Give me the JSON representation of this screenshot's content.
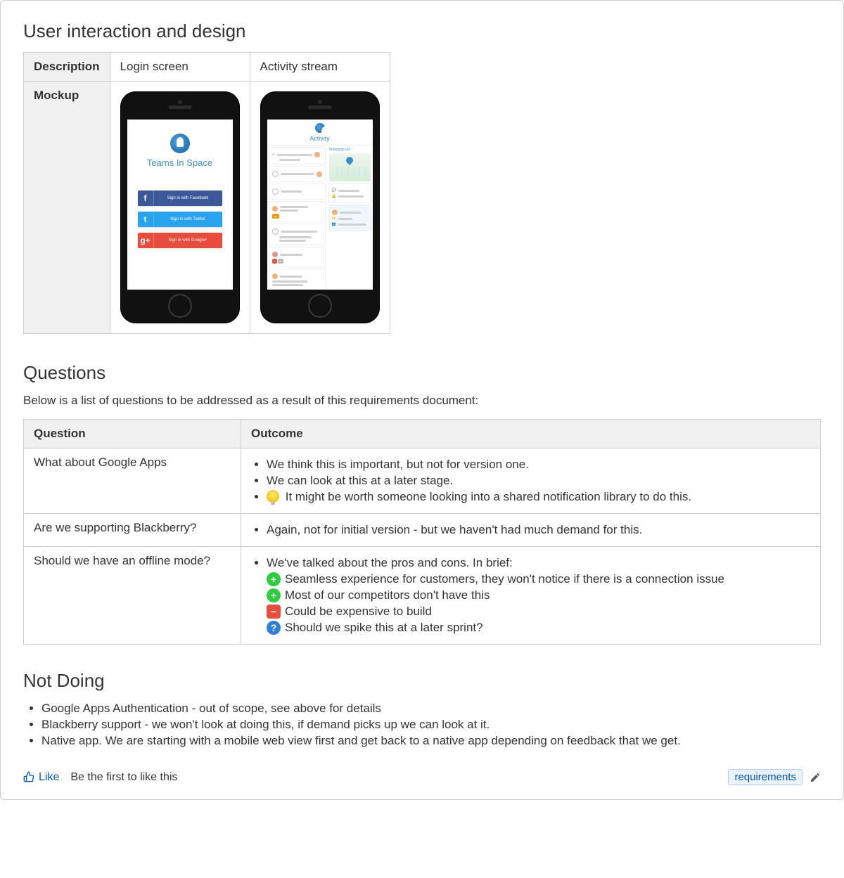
{
  "sections": {
    "design": "User interaction and design",
    "questions": "Questions",
    "notdoing": "Not Doing"
  },
  "mockup_table": {
    "row_desc": "Description",
    "row_mockup": "Mockup",
    "cols": [
      "Login screen",
      "Activity stream"
    ]
  },
  "login_mock": {
    "brand": "Teams In Space",
    "fb": "Sign in with Facebook",
    "tw": "Sign in with Twitter",
    "gp": "Sign in with Google+"
  },
  "activity_mock": {
    "title": "Activity",
    "chart_label": "Shopping cart"
  },
  "questions_intro": "Below is a list of questions to be addressed as a result of this requirements document:",
  "qa_headers": {
    "q": "Question",
    "o": "Outcome"
  },
  "qa": [
    {
      "question": "What about Google Apps",
      "outcome_type": "mixed",
      "outcome": [
        {
          "icon": "",
          "text": "We think this is important, but not for version one."
        },
        {
          "icon": "",
          "text": "We can look at this at a later stage."
        },
        {
          "icon": "bulb",
          "text": "It might be worth someone looking into a shared notification library to do this."
        }
      ]
    },
    {
      "question": "Are we supporting Blackberry?",
      "outcome_type": "plain",
      "outcome": [
        {
          "icon": "",
          "text": "Again, not for initial version - but we haven't had much demand for this."
        }
      ]
    },
    {
      "question": "Should we have an offline mode?",
      "outcome_type": "proscons",
      "lead": "We've talked about the pros and cons. In brief:",
      "outcome": [
        {
          "icon": "plus",
          "text": "Seamless experience for customers, they won't notice if there is a connection issue"
        },
        {
          "icon": "plus",
          "text": "Most of our competitors don't have this"
        },
        {
          "icon": "minus",
          "text": "Could be expensive to build"
        },
        {
          "icon": "q",
          "text": "Should we spike this at a later sprint?"
        }
      ]
    }
  ],
  "notdoing_items": [
    "Google Apps Authentication - out of scope, see above for details",
    "Blackberry support - we won't look at doing this, if demand picks up we can look at it.",
    "Native app. We are starting with a mobile web view first and get back to a native app depending on feedback that we get."
  ],
  "footer": {
    "like": "Like",
    "first": "Be the first to like this",
    "tag": "requirements"
  }
}
